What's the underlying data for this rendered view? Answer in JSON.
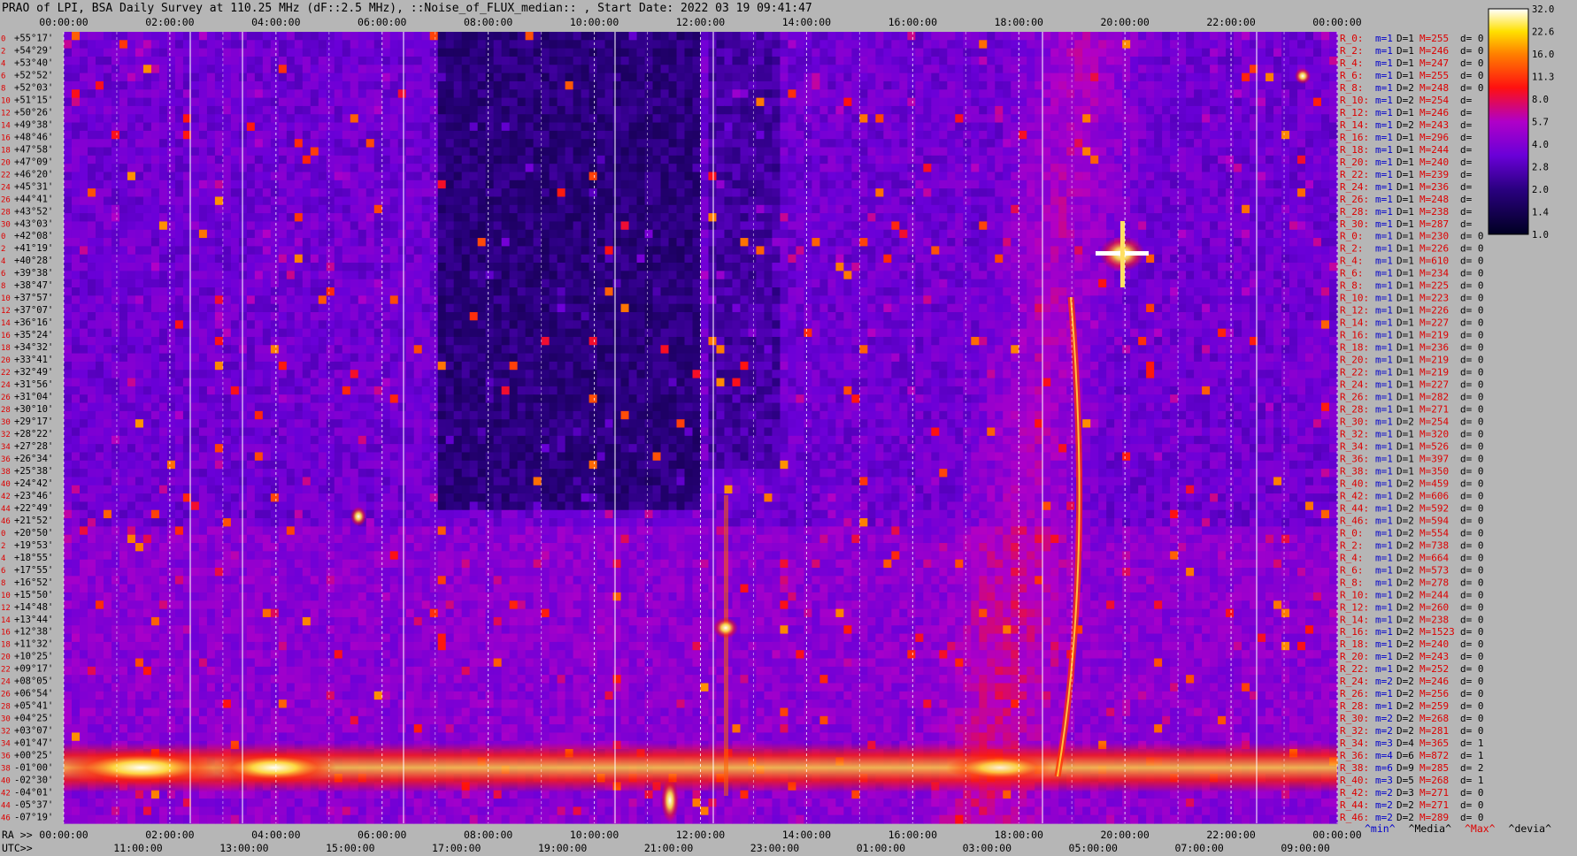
{
  "title": "PRAO of LPI, BSA Daily Survey at 110.25 MHz (dF::2.5 MHz), ::Noise_of_FLUX_median:: , Start Date: 2022 03 19 09:41:47",
  "chart_data": {
    "type": "heatmap",
    "x_top_ticks": [
      "00:00:00",
      "02:00:00",
      "04:00:00",
      "06:00:00",
      "08:00:00",
      "10:00:00",
      "12:00:00",
      "14:00:00",
      "16:00:00",
      "18:00:00",
      "20:00:00",
      "22:00:00",
      "00:00:00"
    ],
    "x_ra_prefix": "RA >>",
    "x_ra_ticks": [
      "00:00:00",
      "02:00:00",
      "04:00:00",
      "06:00:00",
      "08:00:00",
      "10:00:00",
      "12:00:00",
      "14:00:00",
      "16:00:00",
      "18:00:00",
      "20:00:00",
      "22:00:00",
      "00:00:00"
    ],
    "x_utc_prefix": "UTC>>",
    "x_utc_ticks": [
      "11:00:00",
      "13:00:00",
      "15:00:00",
      "17:00:00",
      "19:00:00",
      "21:00:00",
      "23:00:00",
      "01:00:00",
      "03:00:00",
      "05:00:00",
      "07:00:00",
      "09:00:00"
    ],
    "y_ticks": [
      "+55°17'",
      "+54°29'",
      "+53°40'",
      "+52°52'",
      "+52°03'",
      "+51°15'",
      "+50°26'",
      "+49°38'",
      "+48°46'",
      "+47°58'",
      "+47°09'",
      "+46°20'",
      "+45°31'",
      "+44°41'",
      "+43°52'",
      "+43°03'",
      "+42°08'",
      "+41°19'",
      "+40°28'",
      "+39°38'",
      "+38°47'",
      "+37°57'",
      "+37°07'",
      "+36°16'",
      "+35°24'",
      "+34°32'",
      "+33°41'",
      "+32°49'",
      "+31°56'",
      "+31°04'",
      "+30°10'",
      "+29°17'",
      "+28°22'",
      "+27°28'",
      "+26°34'",
      "+25°38'",
      "+24°42'",
      "+23°46'",
      "+22°49'",
      "+21°52'",
      "+20°50'",
      "+19°53'",
      "+18°55'",
      "+17°55'",
      "+16°52'",
      "+15°50'",
      "+14°48'",
      "+13°44'",
      "+12°38'",
      "+11°32'",
      "+10°25'",
      "+09°17'",
      "+08°05'",
      "+06°54'",
      "+05°41'",
      "+04°25'",
      "+03°07'",
      "+01°47'",
      "+00°25'",
      "-01°00'",
      "-02°30'",
      "-04°01'",
      "-05°37'",
      "-07°19'"
    ],
    "y_index": [
      "0",
      "2",
      "4",
      "6",
      "8",
      "10",
      "12",
      "14",
      "16",
      "18",
      "20",
      "22",
      "24",
      "26",
      "28",
      "30",
      "0",
      "2",
      "4",
      "6",
      "8",
      "10",
      "12",
      "14",
      "16",
      "18",
      "20",
      "22",
      "24",
      "26",
      "28",
      "30",
      "32",
      "34",
      "36",
      "38",
      "40",
      "42",
      "44",
      "46",
      "0",
      "2",
      "4",
      "6",
      "8",
      "10",
      "12",
      "14",
      "16",
      "18",
      "20",
      "22",
      "24",
      "26",
      "28",
      "30",
      "32",
      "34",
      "36",
      "38",
      "40",
      "42",
      "44",
      "46"
    ],
    "colorbar": {
      "ticks": [
        "32.0",
        "22.6",
        "16.0",
        "11.3",
        "8.0",
        "5.7",
        "4.0",
        "2.8",
        "2.0",
        "1.4",
        "1.0"
      ],
      "scale": "log",
      "range": [
        1.0,
        32.0
      ]
    },
    "colors": {
      "background": "#b6b6b6",
      "low": "#000033",
      "mid": "#6600cc",
      "high": "#ff2000",
      "peak": "#ffffff",
      "label_red": "#dd0000",
      "label_blue": "#0000cc"
    },
    "receiver_stats": [
      {
        "r": "R_0:",
        "m": "m=1",
        "D": "D=1",
        "M": "M=255",
        "d": "d= 0"
      },
      {
        "r": "R_2:",
        "m": "m=1",
        "D": "D=1",
        "M": "M=246",
        "d": "d= 0"
      },
      {
        "r": "R_4:",
        "m": "m=1",
        "D": "D=1",
        "M": "M=247",
        "d": "d= 0"
      },
      {
        "r": "R_6:",
        "m": "m=1",
        "D": "D=1",
        "M": "M=255",
        "d": "d= 0"
      },
      {
        "r": "R_8:",
        "m": "m=1",
        "D": "D=2",
        "M": "M=248",
        "d": "d= 0"
      },
      {
        "r": "R_10:",
        "m": "m=1",
        "D": "D=2",
        "M": "M=254",
        "d": "d="
      },
      {
        "r": "R_12:",
        "m": "m=1",
        "D": "D=1",
        "M": "M=246",
        "d": "d="
      },
      {
        "r": "R_14:",
        "m": "m=1",
        "D": "D=2",
        "M": "M=243",
        "d": "d="
      },
      {
        "r": "R_16:",
        "m": "m=1",
        "D": "D=1",
        "M": "M=296",
        "d": "d="
      },
      {
        "r": "R_18:",
        "m": "m=1",
        "D": "D=1",
        "M": "M=244",
        "d": "d="
      },
      {
        "r": "R_20:",
        "m": "m=1",
        "D": "D=1",
        "M": "M=240",
        "d": "d="
      },
      {
        "r": "R_22:",
        "m": "m=1",
        "D": "D=1",
        "M": "M=239",
        "d": "d="
      },
      {
        "r": "R_24:",
        "m": "m=1",
        "D": "D=1",
        "M": "M=236",
        "d": "d="
      },
      {
        "r": "R_26:",
        "m": "m=1",
        "D": "D=1",
        "M": "M=248",
        "d": "d="
      },
      {
        "r": "R_28:",
        "m": "m=1",
        "D": "D=1",
        "M": "M=238",
        "d": "d="
      },
      {
        "r": "R_30:",
        "m": "m=1",
        "D": "D=1",
        "M": "M=287",
        "d": "d="
      },
      {
        "r": "R_0:",
        "m": "m=1",
        "D": "D=1",
        "M": "M=230",
        "d": "d= 0"
      },
      {
        "r": "R_2:",
        "m": "m=1",
        "D": "D=1",
        "M": "M=226",
        "d": "d= 0"
      },
      {
        "r": "R_4:",
        "m": "m=1",
        "D": "D=1",
        "M": "M=610",
        "d": "d= 0"
      },
      {
        "r": "R_6:",
        "m": "m=1",
        "D": "D=1",
        "M": "M=234",
        "d": "d= 0"
      },
      {
        "r": "R_8:",
        "m": "m=1",
        "D": "D=1",
        "M": "M=225",
        "d": "d= 0"
      },
      {
        "r": "R_10:",
        "m": "m=1",
        "D": "D=1",
        "M": "M=223",
        "d": "d= 0"
      },
      {
        "r": "R_12:",
        "m": "m=1",
        "D": "D=1",
        "M": "M=226",
        "d": "d= 0"
      },
      {
        "r": "R_14:",
        "m": "m=1",
        "D": "D=1",
        "M": "M=227",
        "d": "d= 0"
      },
      {
        "r": "R_16:",
        "m": "m=1",
        "D": "D=1",
        "M": "M=219",
        "d": "d= 0"
      },
      {
        "r": "R_18:",
        "m": "m=1",
        "D": "D=1",
        "M": "M=236",
        "d": "d= 0"
      },
      {
        "r": "R_20:",
        "m": "m=1",
        "D": "D=1",
        "M": "M=219",
        "d": "d= 0"
      },
      {
        "r": "R_22:",
        "m": "m=1",
        "D": "D=1",
        "M": "M=219",
        "d": "d= 0"
      },
      {
        "r": "R_24:",
        "m": "m=1",
        "D": "D=1",
        "M": "M=227",
        "d": "d= 0"
      },
      {
        "r": "R_26:",
        "m": "m=1",
        "D": "D=1",
        "M": "M=282",
        "d": "d= 0"
      },
      {
        "r": "R_28:",
        "m": "m=1",
        "D": "D=1",
        "M": "M=271",
        "d": "d= 0"
      },
      {
        "r": "R_30:",
        "m": "m=1",
        "D": "D=2",
        "M": "M=254",
        "d": "d= 0"
      },
      {
        "r": "R_32:",
        "m": "m=1",
        "D": "D=1",
        "M": "M=320",
        "d": "d= 0"
      },
      {
        "r": "R_34:",
        "m": "m=1",
        "D": "D=1",
        "M": "M=526",
        "d": "d= 0"
      },
      {
        "r": "R_36:",
        "m": "m=1",
        "D": "D=1",
        "M": "M=397",
        "d": "d= 0"
      },
      {
        "r": "R_38:",
        "m": "m=1",
        "D": "D=1",
        "M": "M=350",
        "d": "d= 0"
      },
      {
        "r": "R_40:",
        "m": "m=1",
        "D": "D=2",
        "M": "M=459",
        "d": "d= 0"
      },
      {
        "r": "R_42:",
        "m": "m=1",
        "D": "D=2",
        "M": "M=606",
        "d": "d= 0"
      },
      {
        "r": "R_44:",
        "m": "m=1",
        "D": "D=2",
        "M": "M=592",
        "d": "d= 0"
      },
      {
        "r": "R_46:",
        "m": "m=1",
        "D": "D=2",
        "M": "M=594",
        "d": "d= 0"
      },
      {
        "r": "R_0:",
        "m": "m=1",
        "D": "D=2",
        "M": "M=554",
        "d": "d= 0"
      },
      {
        "r": "R_2:",
        "m": "m=1",
        "D": "D=2",
        "M": "M=738",
        "d": "d= 0"
      },
      {
        "r": "R_4:",
        "m": "m=1",
        "D": "D=2",
        "M": "M=664",
        "d": "d= 0"
      },
      {
        "r": "R_6:",
        "m": "m=1",
        "D": "D=2",
        "M": "M=573",
        "d": "d= 0"
      },
      {
        "r": "R_8:",
        "m": "m=1",
        "D": "D=2",
        "M": "M=278",
        "d": "d= 0"
      },
      {
        "r": "R_10:",
        "m": "m=1",
        "D": "D=2",
        "M": "M=244",
        "d": "d= 0"
      },
      {
        "r": "R_12:",
        "m": "m=1",
        "D": "D=2",
        "M": "M=260",
        "d": "d= 0"
      },
      {
        "r": "R_14:",
        "m": "m=1",
        "D": "D=2",
        "M": "M=238",
        "d": "d= 0"
      },
      {
        "r": "R_16:",
        "m": "m=1",
        "D": "D=2",
        "M": "M=1523",
        "d": "d= 0"
      },
      {
        "r": "R_18:",
        "m": "m=1",
        "D": "D=2",
        "M": "M=240",
        "d": "d= 0"
      },
      {
        "r": "R_20:",
        "m": "m=1",
        "D": "D=2",
        "M": "M=243",
        "d": "d= 0"
      },
      {
        "r": "R_22:",
        "m": "m=1",
        "D": "D=2",
        "M": "M=252",
        "d": "d= 0"
      },
      {
        "r": "R_24:",
        "m": "m=2",
        "D": "D=2",
        "M": "M=246",
        "d": "d= 0"
      },
      {
        "r": "R_26:",
        "m": "m=1",
        "D": "D=2",
        "M": "M=256",
        "d": "d= 0"
      },
      {
        "r": "R_28:",
        "m": "m=1",
        "D": "D=2",
        "M": "M=259",
        "d": "d= 0"
      },
      {
        "r": "R_30:",
        "m": "m=2",
        "D": "D=2",
        "M": "M=268",
        "d": "d= 0"
      },
      {
        "r": "R_32:",
        "m": "m=2",
        "D": "D=2",
        "M": "M=281",
        "d": "d= 0"
      },
      {
        "r": "R_34:",
        "m": "m=3",
        "D": "D=4",
        "M": "M=365",
        "d": "d= 1"
      },
      {
        "r": "R_36:",
        "m": "m=4",
        "D": "D=6",
        "M": "M=872",
        "d": "d= 1"
      },
      {
        "r": "R_38:",
        "m": "m=6",
        "D": "D=9",
        "M": "M=285",
        "d": "d= 2"
      },
      {
        "r": "R_40:",
        "m": "m=3",
        "D": "D=5",
        "M": "M=268",
        "d": "d= 1"
      },
      {
        "r": "R_42:",
        "m": "m=2",
        "D": "D=3",
        "M": "M=271",
        "d": "d= 0"
      },
      {
        "r": "R_44:",
        "m": "m=2",
        "D": "D=2",
        "M": "M=271",
        "d": "d= 0"
      },
      {
        "r": "R_46:",
        "m": "m=2",
        "D": "D=2",
        "M": "M=289",
        "d": "d= 0"
      }
    ],
    "legend": {
      "min": "^min^",
      "median": "^Media^",
      "max": "^Max^",
      "devia": "^devia^"
    }
  }
}
